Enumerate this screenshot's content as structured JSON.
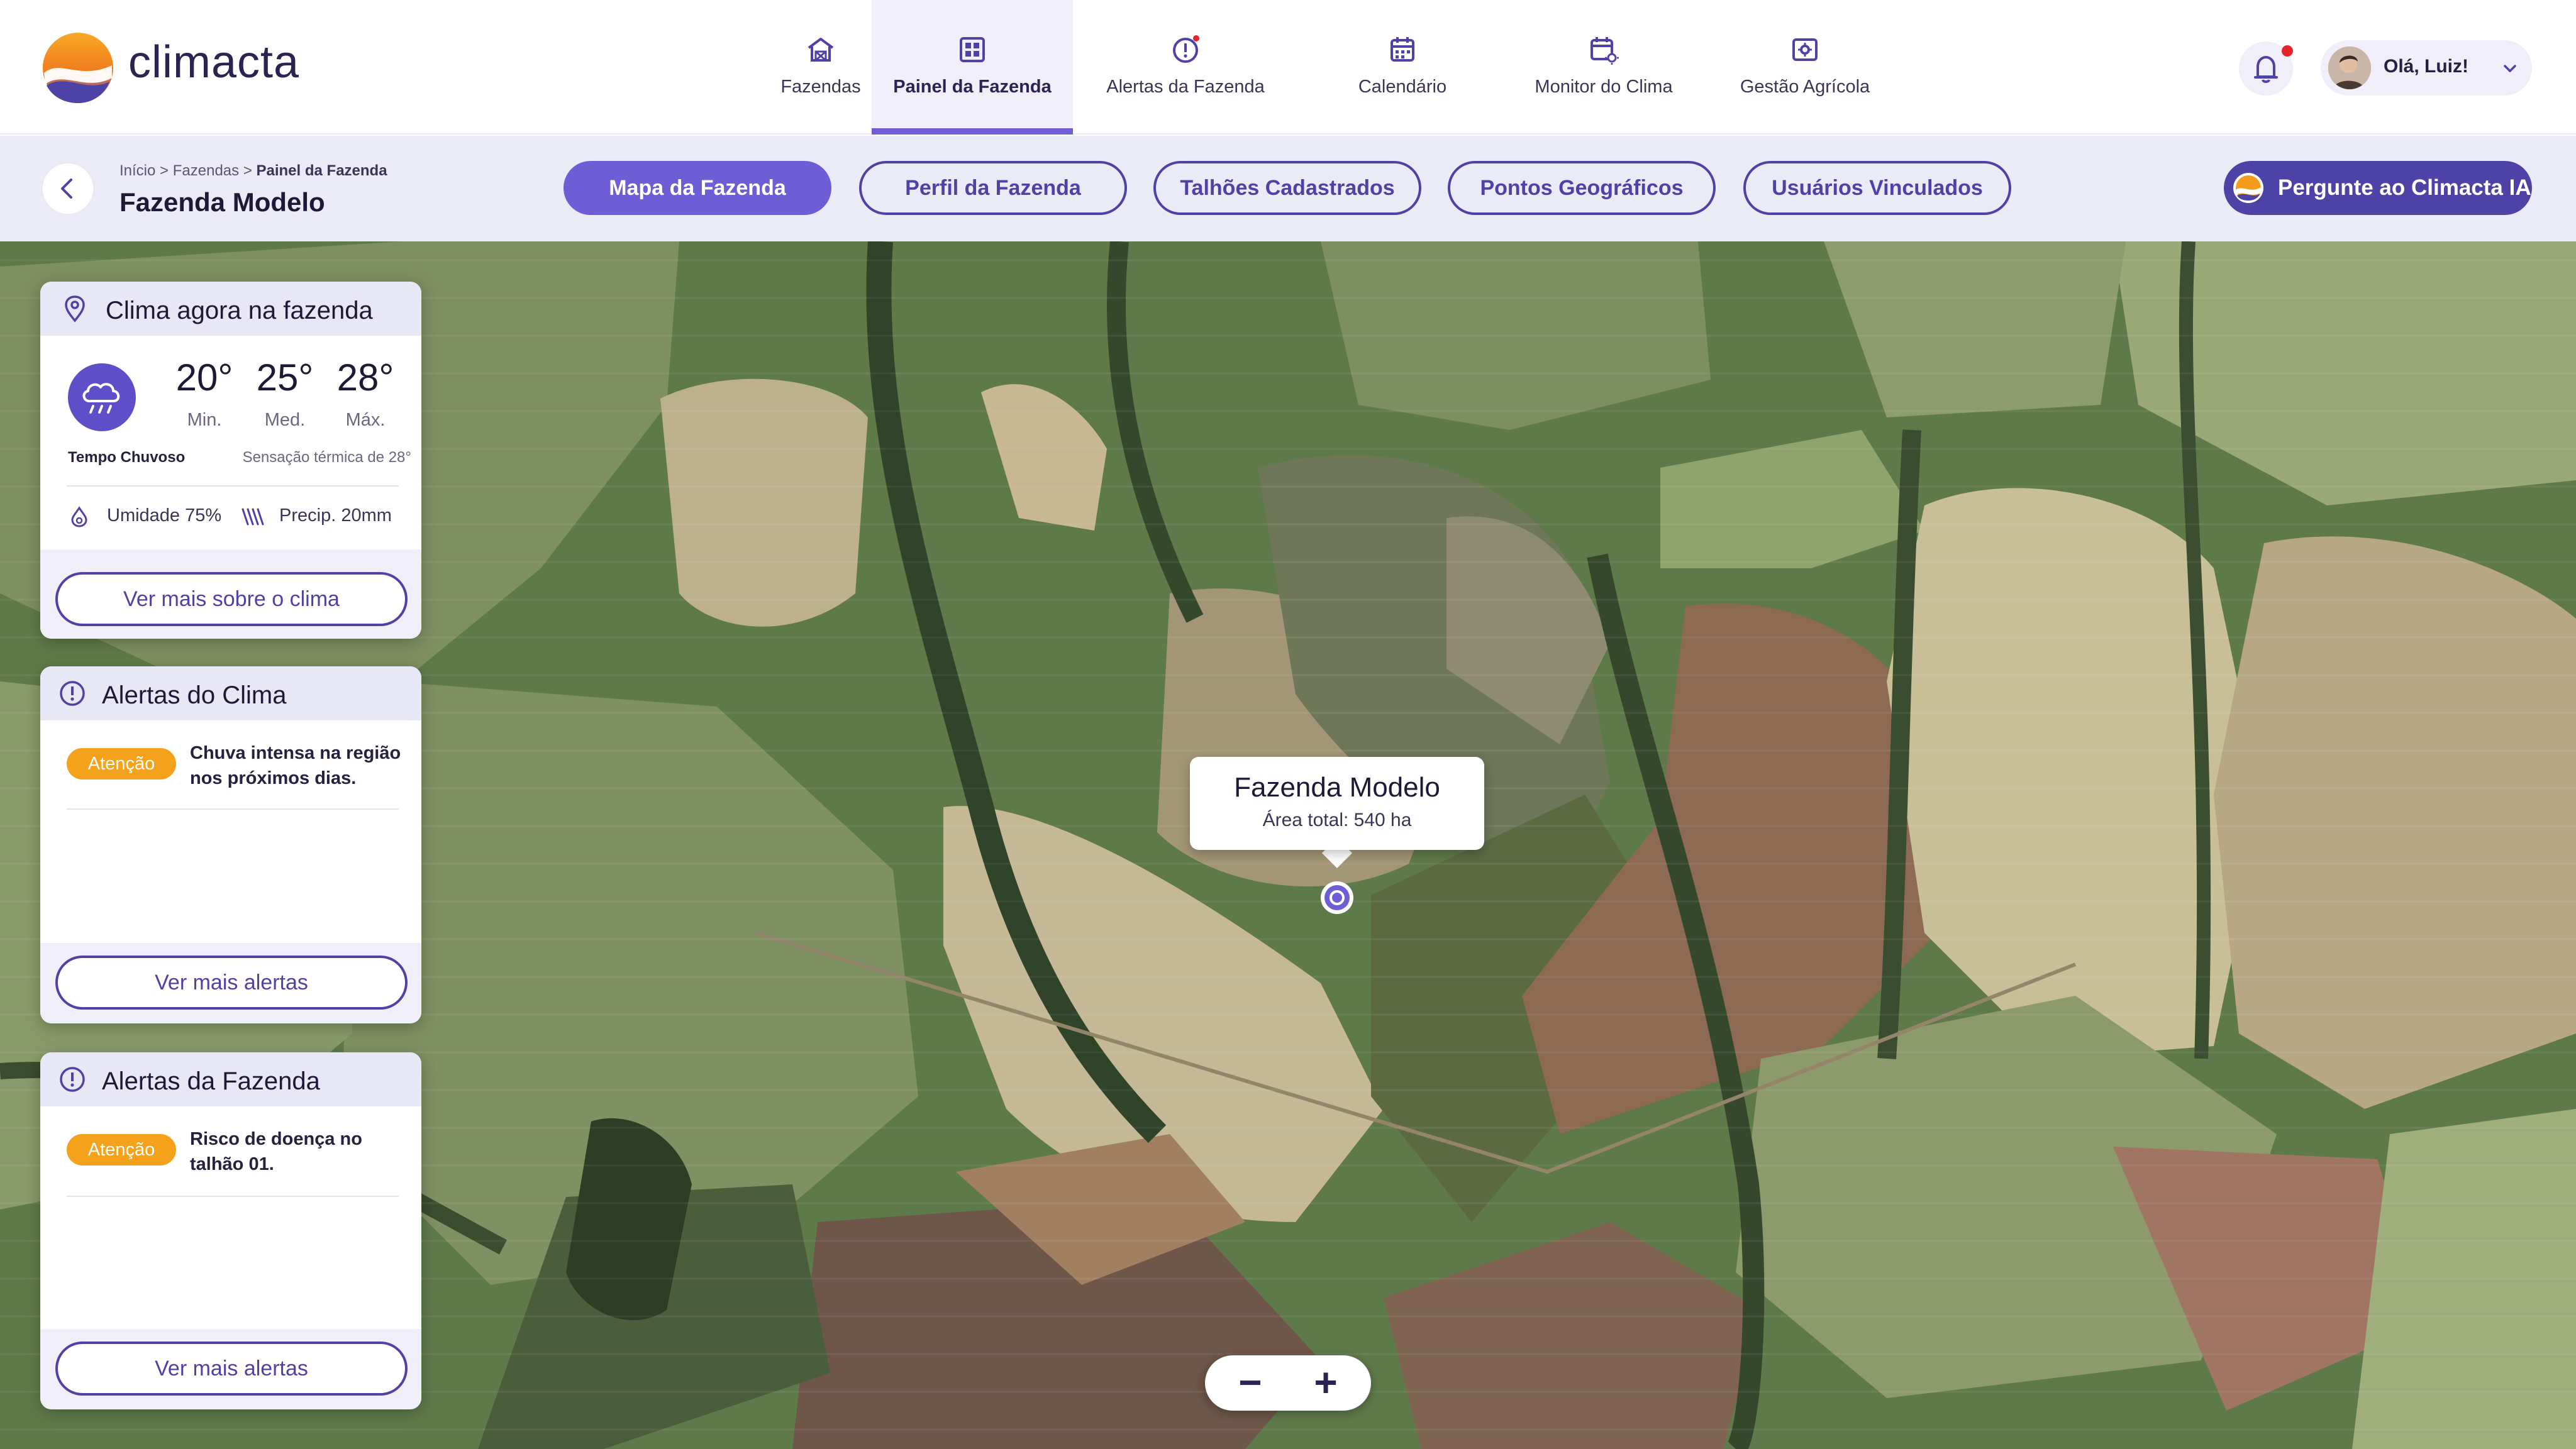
{
  "app": {
    "brand": "climacta",
    "accent": "#6D5ED6",
    "accent_dark": "#4D43A6",
    "warning": "#F4A11B"
  },
  "nav": {
    "items": [
      {
        "label": "Fazendas",
        "icon": "barn-icon",
        "active": false
      },
      {
        "label": "Painel da Fazenda",
        "icon": "dashboard-icon",
        "active": true
      },
      {
        "label": "Alertas da Fazenda",
        "icon": "alert-icon",
        "active": false
      },
      {
        "label": "Calendário",
        "icon": "calendar-icon",
        "active": false
      },
      {
        "label": "Monitor do Clima",
        "icon": "weather-calendar-icon",
        "active": false
      },
      {
        "label": "Gestão Agrícola",
        "icon": "management-icon",
        "active": false
      }
    ],
    "greeting": "Olá, Luiz!"
  },
  "subheader": {
    "breadcrumb": {
      "home": "Início",
      "sep": ">",
      "farms": "Fazendas",
      "current": "Painel da Fazenda"
    },
    "title": "Fazenda Modelo",
    "tabs": [
      {
        "label": "Mapa da Fazenda",
        "active": true
      },
      {
        "label": "Perfil da Fazenda",
        "active": false
      },
      {
        "label": "Talhões Cadastrados",
        "active": false
      },
      {
        "label": "Pontos Geográficos",
        "active": false
      },
      {
        "label": "Usuários Vinculados",
        "active": false
      }
    ],
    "ai_button": "Pergunte ao Climacta IA"
  },
  "weather_card": {
    "title": "Clima agora na fazenda",
    "condition": "Tempo Chuvoso",
    "feels_like": "Sensação térmica de 28°",
    "temps": [
      {
        "value": "20°",
        "label": "Min."
      },
      {
        "value": "25°",
        "label": "Med."
      },
      {
        "value": "28°",
        "label": "Máx."
      }
    ],
    "humidity": "Umidade 75%",
    "precip": "Precip. 20mm",
    "button": "Ver mais sobre o clima"
  },
  "climate_alerts": {
    "title": "Alertas do Clima",
    "items": [
      {
        "badge": "Atenção",
        "text": "Chuva intensa na região nos próximos dias."
      }
    ],
    "button": "Ver mais alertas"
  },
  "farm_alerts": {
    "title": "Alertas da Fazenda",
    "items": [
      {
        "badge": "Atenção",
        "text": "Risco de doença no talhão 01."
      }
    ],
    "button": "Ver mais alertas"
  },
  "map": {
    "popup_title": "Fazenda Modelo",
    "popup_area": "Área total: 540 ha",
    "zoom_out": "−",
    "zoom_in": "+"
  }
}
